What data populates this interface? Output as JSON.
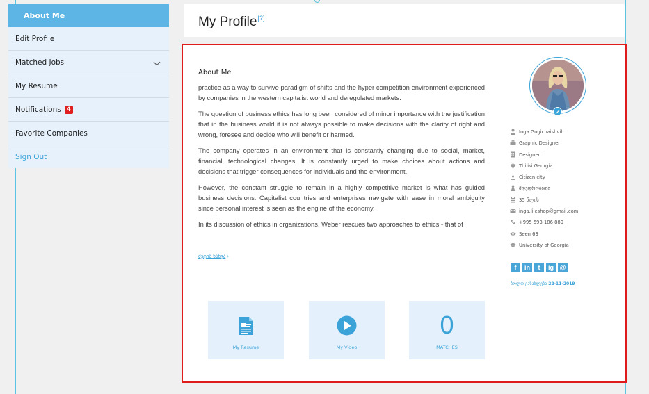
{
  "sidebar": {
    "header": "About Me",
    "items": [
      {
        "label": "Edit Profile"
      },
      {
        "label": "Matched Jobs"
      },
      {
        "label": "My Resume"
      },
      {
        "label": "Notifications",
        "badge": "4"
      },
      {
        "label": "Favorite Companies"
      },
      {
        "label": "Sign Out"
      }
    ]
  },
  "header": {
    "title": "My Profile",
    "help": "[?]"
  },
  "about": {
    "title": "About Me",
    "paragraphs": [
      "practice as a way to survive paradigm of shifts and the hyper competition environment experienced by companies in the western capitalist world and deregulated markets.",
      "The question of business ethics has long been considered of minor importance with the justification that in the business world it is not always possible to make decisions with the clarity of right and wrong, foresee and decide who will benefit or harmed.",
      "The company operates in an environment that is constantly changing due to social, market, financial, technological changes. It is constantly urged to make choices about actions and decisions that trigger consequences for individuals and the environment.",
      "However, the constant struggle to remain in a highly competitive market is what has guided business decisions. Capitalist countries and enterprises navigate with ease in moral ambiguity since personal interest is seen as the engine of the economy.",
      " In its discussion of ethics in organizations, Weber rescues two approaches to ethics - that of"
    ],
    "more_label": "მეტის ნახვა",
    "more_arrow": "›"
  },
  "cards": [
    {
      "label": "My Resume",
      "icon": "document-icon"
    },
    {
      "label": "My Video",
      "icon": "play-icon"
    },
    {
      "label": "MATCHES",
      "value": "0"
    }
  ],
  "profile": {
    "info": [
      {
        "icon": "user-icon",
        "text": "Inga Gogichaishvili"
      },
      {
        "icon": "briefcase-icon",
        "text": "Graphic Designer"
      },
      {
        "icon": "building-icon",
        "text": "Designer"
      },
      {
        "icon": "location-icon",
        "text": "Tbilisi Georgia"
      },
      {
        "icon": "passport-icon",
        "text": "Citizen city"
      },
      {
        "icon": "gender-icon",
        "text": "მდედრობითი"
      },
      {
        "icon": "calendar-icon",
        "text": "35 წლის"
      },
      {
        "icon": "mail-icon",
        "text": "inga.lileshop@gmail.com"
      },
      {
        "icon": "phone-icon",
        "text": "+995 593 186 889"
      },
      {
        "icon": "eye-icon",
        "text": "Seen 63"
      },
      {
        "icon": "graduation-icon",
        "text": "University of Georgia"
      }
    ],
    "social": [
      "f",
      "in",
      "t",
      "ig",
      "@"
    ],
    "updated_label": "ბოლო განახლება",
    "updated_date": "22-11-2019"
  },
  "colors": {
    "accent": "#3ba3d8",
    "sidebar_head": "#5db5e5",
    "highlight_border": "#e01b1b",
    "card_bg": "#e4f1fc"
  }
}
